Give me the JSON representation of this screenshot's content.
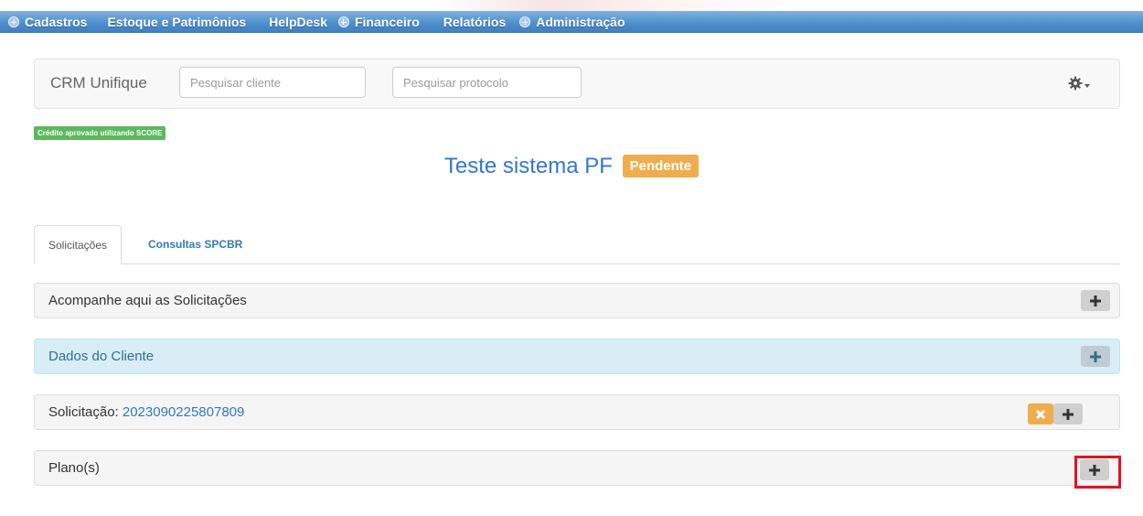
{
  "menu": {
    "items": [
      {
        "label": "Cadastros",
        "has_plus": true
      },
      {
        "label": "Estoque e Patrimônios",
        "has_plus": false
      },
      {
        "label": "HelpDesk",
        "has_plus": false
      },
      {
        "label": "Financeiro",
        "has_plus": true
      },
      {
        "label": "Relatórios",
        "has_plus": false
      },
      {
        "label": "Administração",
        "has_plus": true
      }
    ]
  },
  "crm": {
    "brand": "CRM Unifique",
    "search_client_placeholder": "Pesquisar cliente",
    "search_protocol_placeholder": "Pesquisar protocolo",
    "settings_icon": "gear-icon"
  },
  "credit_badge": "Crédito aprovado utilizando SCORE",
  "client": {
    "name": "Teste sistema PF",
    "status": "Pendente"
  },
  "tabs": [
    {
      "label": "Solicitações",
      "active": true
    },
    {
      "label": "Consultas SPCBR",
      "active": false
    }
  ],
  "panels": {
    "tracking": {
      "title": "Acompanhe aqui as Solicitações"
    },
    "client_data": {
      "title": "Dados do Cliente"
    },
    "request": {
      "label": "Solicitação: ",
      "number": "2023090225807809"
    },
    "plans": {
      "title": "Plano(s)"
    }
  },
  "colors": {
    "menu_bar": "#4f8fcd",
    "link": "#337ab7",
    "success": "#5cb85c",
    "warning": "#f0ad4e",
    "info_panel": "#d9edf7",
    "highlight": "#e2141f"
  }
}
